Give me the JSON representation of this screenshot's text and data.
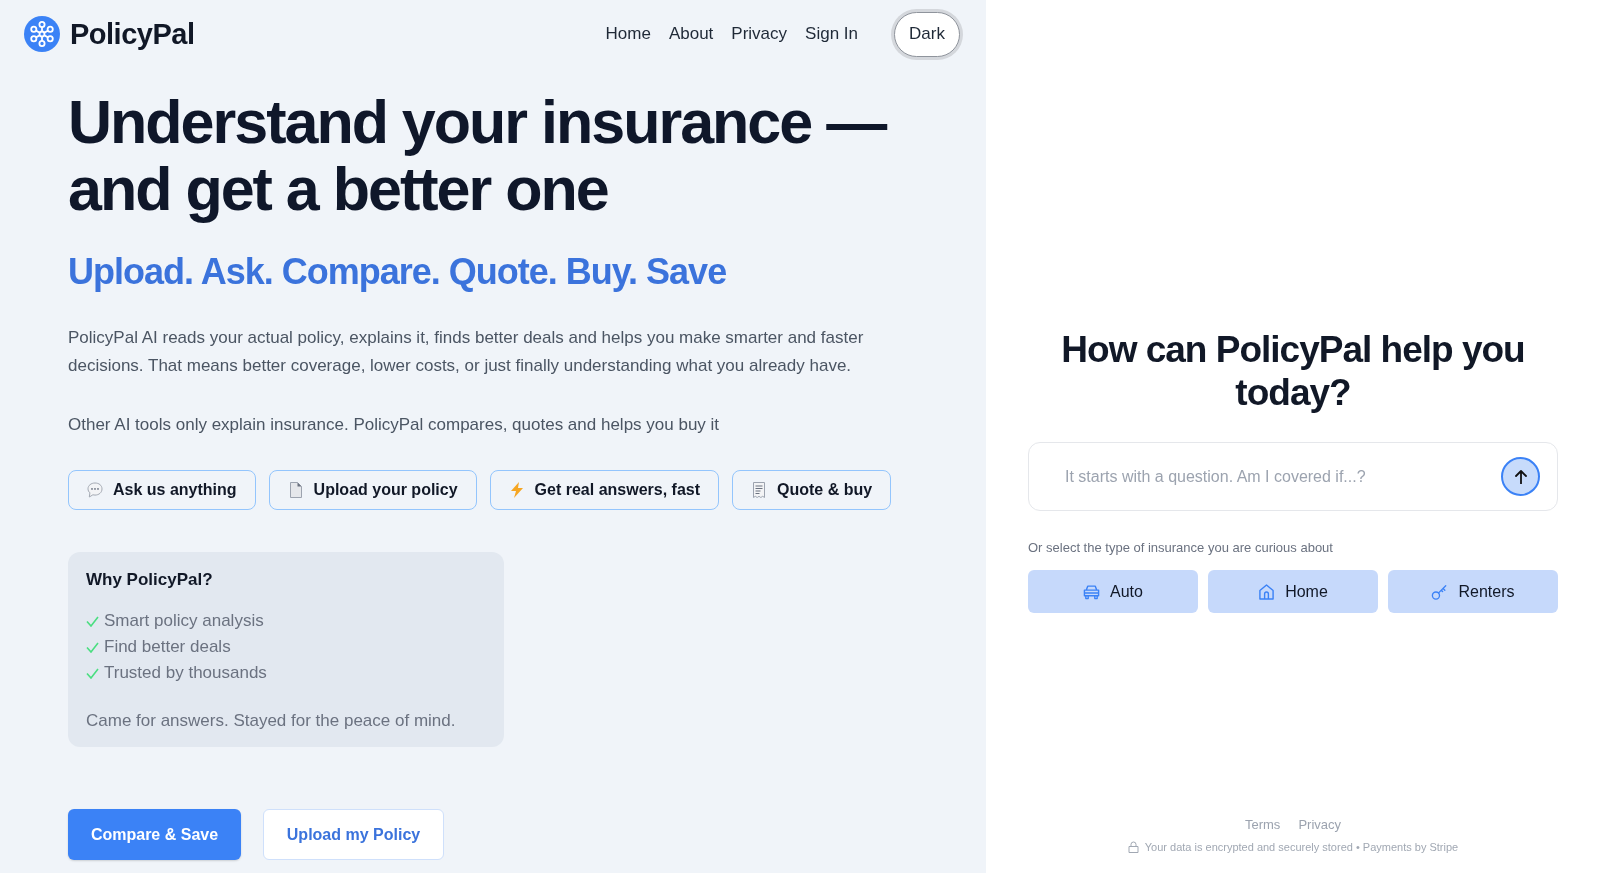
{
  "header": {
    "logo": "PolicyPal",
    "nav": [
      "Home",
      "About",
      "Privacy",
      "Sign In"
    ],
    "theme_button": "Dark"
  },
  "hero": {
    "headline": "Understand your insurance — and get a better one",
    "tagline": "Upload. Ask. Compare. Quote. Buy. Save",
    "description": "PolicyPal AI reads your actual policy, explains it, finds better deals and helps you make smarter and faster decisions. That means better coverage, lower costs, or just finally understanding what you already have.",
    "note": "Other AI tools only explain insurance. PolicyPal compares, quotes and helps you buy it"
  },
  "features": [
    {
      "kind": "chat",
      "label": "Ask us anything"
    },
    {
      "kind": "document",
      "label": "Upload your policy"
    },
    {
      "kind": "lightning",
      "label": "Get real answers, fast"
    },
    {
      "kind": "receipt",
      "label": "Quote & buy"
    }
  ],
  "why_card": {
    "title": "Why PolicyPal?",
    "points": [
      "Smart policy analysis",
      "Find better deals",
      "Trusted by thousands"
    ],
    "closing": "Came for answers. Stayed for the peace of mind."
  },
  "actions": [
    {
      "kind": "primary",
      "label": "Compare & Save"
    },
    {
      "kind": "secondary",
      "label": "Upload my Policy"
    }
  ],
  "assistant": {
    "title": "How can PolicyPal help you today?",
    "input": {
      "placeholder": "It starts with a question. Am I covered if...?"
    },
    "prompt": "Or select the type of insurance you are curious about",
    "insurance_types": [
      {
        "kind": "car",
        "label": "Auto"
      },
      {
        "kind": "house",
        "label": "Home"
      },
      {
        "kind": "key",
        "label": "Renters"
      }
    ]
  },
  "footer": {
    "links": [
      "Terms",
      "Privacy"
    ],
    "security_note": "Your data is encrypted and securely stored • Payments by Stripe"
  }
}
